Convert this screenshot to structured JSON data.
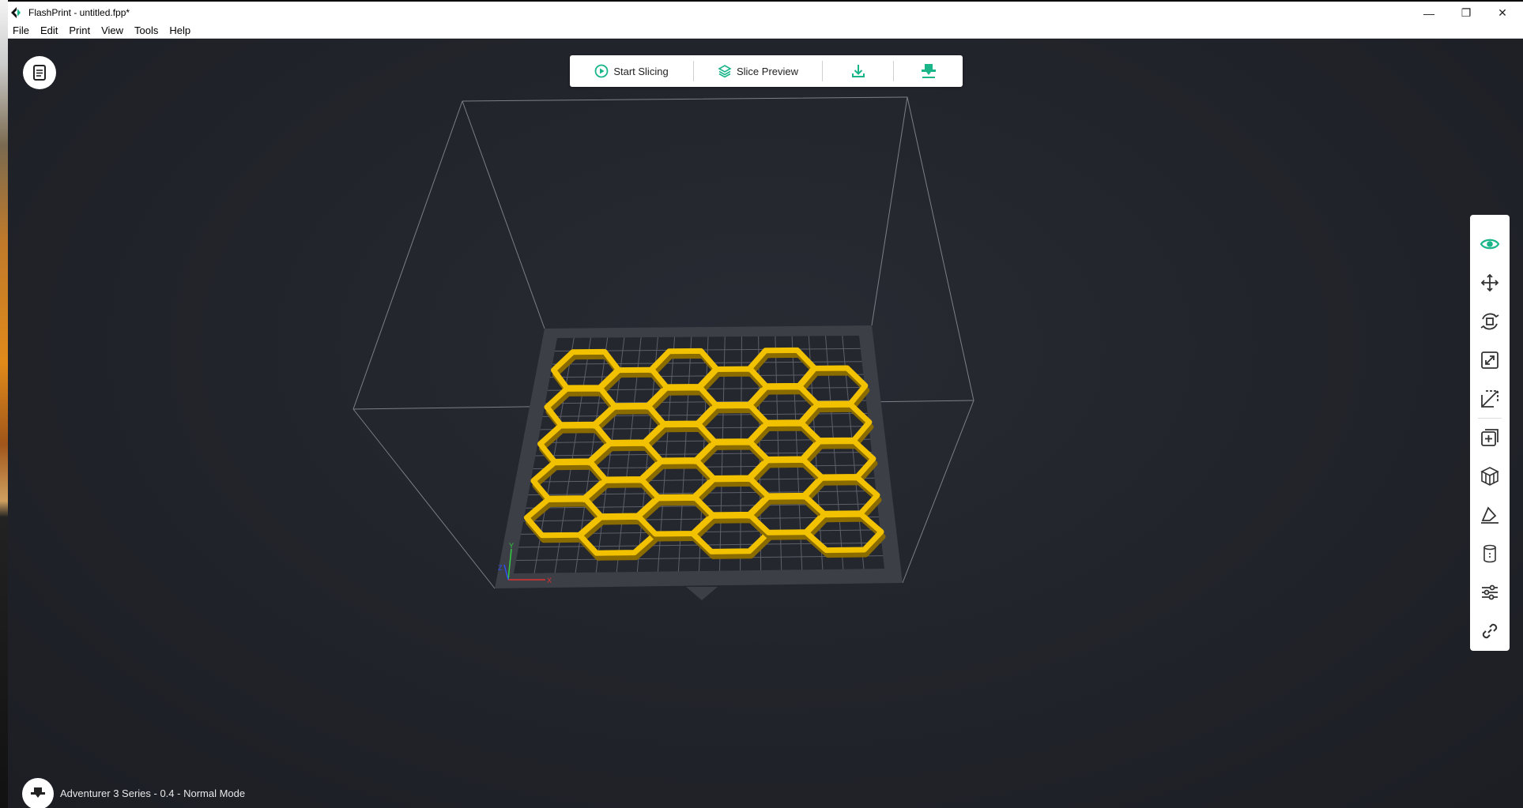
{
  "window": {
    "title": "FlashPrint - untitled.fpp*",
    "minimize_glyph": "—",
    "restore_glyph": "❐",
    "close_glyph": "✕"
  },
  "menu": [
    "File",
    "Edit",
    "Print",
    "View",
    "Tools",
    "Help"
  ],
  "toolbar": {
    "start_slicing_label": "Start Slicing",
    "slice_preview_label": "Slice Preview",
    "export_icon": "download-icon",
    "printer_icon": "nozzle-icon"
  },
  "right_toolbar": [
    {
      "name": "view",
      "icon": "eye-icon",
      "active": true
    },
    {
      "name": "move",
      "icon": "move-icon"
    },
    {
      "name": "rotate",
      "icon": "rotate-icon"
    },
    {
      "name": "scale",
      "icon": "scale-icon"
    },
    {
      "name": "cut",
      "icon": "cut-icon"
    },
    {
      "name": "add-model",
      "icon": "add-model-icon"
    },
    {
      "name": "supports",
      "icon": "supports-icon"
    },
    {
      "name": "place-on-face",
      "icon": "lay-flat-icon"
    },
    {
      "name": "extruder",
      "icon": "cylinder-icon"
    },
    {
      "name": "print-settings",
      "icon": "sliders-icon"
    },
    {
      "name": "link",
      "icon": "link-icon"
    }
  ],
  "status": {
    "printer_info": "Adventurer 3 Series - 0.4 - Normal Mode"
  },
  "axes": {
    "x": "X",
    "y": "Y",
    "z": "Z"
  },
  "colors": {
    "accent": "#1bb58a",
    "model": "#f2c200",
    "background": "#22242b",
    "plate": "#3d3f47"
  }
}
